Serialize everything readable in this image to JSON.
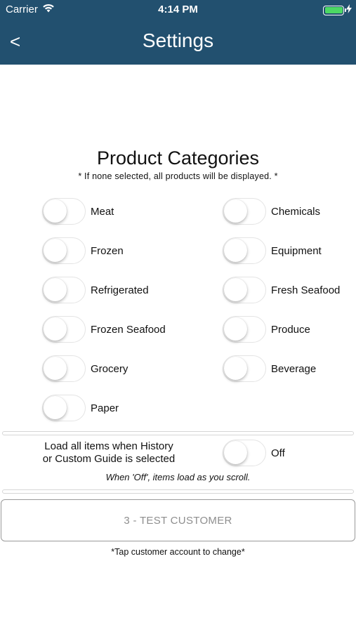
{
  "status_bar": {
    "carrier": "Carrier",
    "time": "4:14 PM",
    "battery_color": "#4cd964"
  },
  "nav": {
    "back_label": "<",
    "title": "Settings",
    "bar_color": "#22506f"
  },
  "categories": {
    "title": "Product Categories",
    "note": "* If none selected, all products will be displayed. *",
    "items": [
      {
        "label": "Meat",
        "on": false
      },
      {
        "label": "Chemicals",
        "on": false
      },
      {
        "label": "Frozen",
        "on": false
      },
      {
        "label": "Equipment",
        "on": false
      },
      {
        "label": "Refrigerated",
        "on": false
      },
      {
        "label": "Fresh Seafood",
        "on": false
      },
      {
        "label": "Frozen Seafood",
        "on": false
      },
      {
        "label": "Produce",
        "on": false
      },
      {
        "label": "Grocery",
        "on": false
      },
      {
        "label": "Beverage",
        "on": false
      },
      {
        "label": "Paper",
        "on": false
      }
    ]
  },
  "load_all": {
    "label_line1": "Load all items when History",
    "label_line2": "or Custom Guide is selected",
    "state_label": "Off",
    "on": false,
    "note": "When 'Off', items load as you scroll."
  },
  "customer": {
    "button_label": "3 - TEST CUSTOMER",
    "hint": "*Tap customer account to change*"
  }
}
